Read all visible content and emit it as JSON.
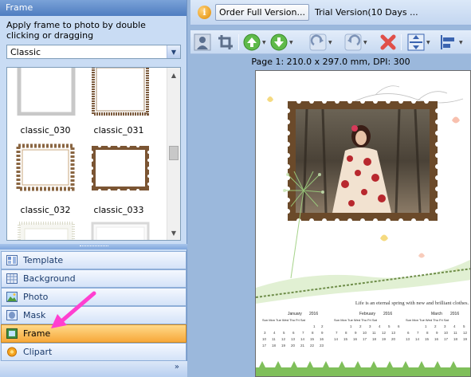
{
  "left_panel": {
    "title": "Frame",
    "instruction": "Apply frame to photo by double clicking or dragging",
    "category_select": {
      "value": "Classic"
    },
    "frames": [
      {
        "label": "",
        "style": "plain-white"
      },
      {
        "label": "",
        "style": "brown-filigree"
      },
      {
        "label": "classic_030",
        "style": "plain-white"
      },
      {
        "label": "classic_031",
        "style": "brown-filigree"
      },
      {
        "label": "classic_032",
        "style": "brown-beaded"
      },
      {
        "label": "classic_033",
        "style": "brown-stamp"
      },
      {
        "label": "",
        "style": "light-lace"
      },
      {
        "label": "",
        "style": "light-plain"
      }
    ],
    "nav": [
      {
        "label": "Template",
        "icon": "template-icon",
        "active": false
      },
      {
        "label": "Background",
        "icon": "background-icon",
        "active": false
      },
      {
        "label": "Photo",
        "icon": "photo-icon",
        "active": false
      },
      {
        "label": "Mask",
        "icon": "mask-icon",
        "active": false
      },
      {
        "label": "Frame",
        "icon": "frame-icon",
        "active": true
      },
      {
        "label": "Clipart",
        "icon": "clipart-icon",
        "active": false
      }
    ],
    "more_glyph": "»"
  },
  "top_bar": {
    "info_glyph": "i",
    "order_button": "Order Full Version...",
    "trial_text": "Trial Version(10 Days ..."
  },
  "toolbar": {
    "buttons": [
      "person-icon",
      "crop-icon",
      "move-up-icon",
      "move-down-icon",
      "redo-icon",
      "undo-icon",
      "delete-icon",
      "align-vertical-icon",
      "align-left-icon"
    ]
  },
  "page_info": "Page 1: 210.0 x 297.0 mm, DPI: 300",
  "document": {
    "quote": "Life is an eternal spring with new and brilliant clothes.",
    "calendar_year": "2016",
    "months": [
      {
        "name": "January",
        "year": "2016",
        "days": "Sun Mon Tue Wed Thu Fri Sat"
      },
      {
        "name": "February",
        "year": "2016",
        "days": "Sun Mon Tue Wed Thu Fri Sat"
      },
      {
        "name": "March",
        "year": "2016",
        "days": "Sun Mon Tue Wed Thu Fri Sat"
      }
    ],
    "colors": {
      "frame_brown": "#6b4a2a",
      "leaf_green": "#8fbf6a",
      "heart_yellow": "#f2c94c"
    }
  },
  "colors": {
    "panel_bg": "#c9dcf4",
    "active_nav": "#f7a83a",
    "arrow_pink": "#ff3fd0"
  }
}
